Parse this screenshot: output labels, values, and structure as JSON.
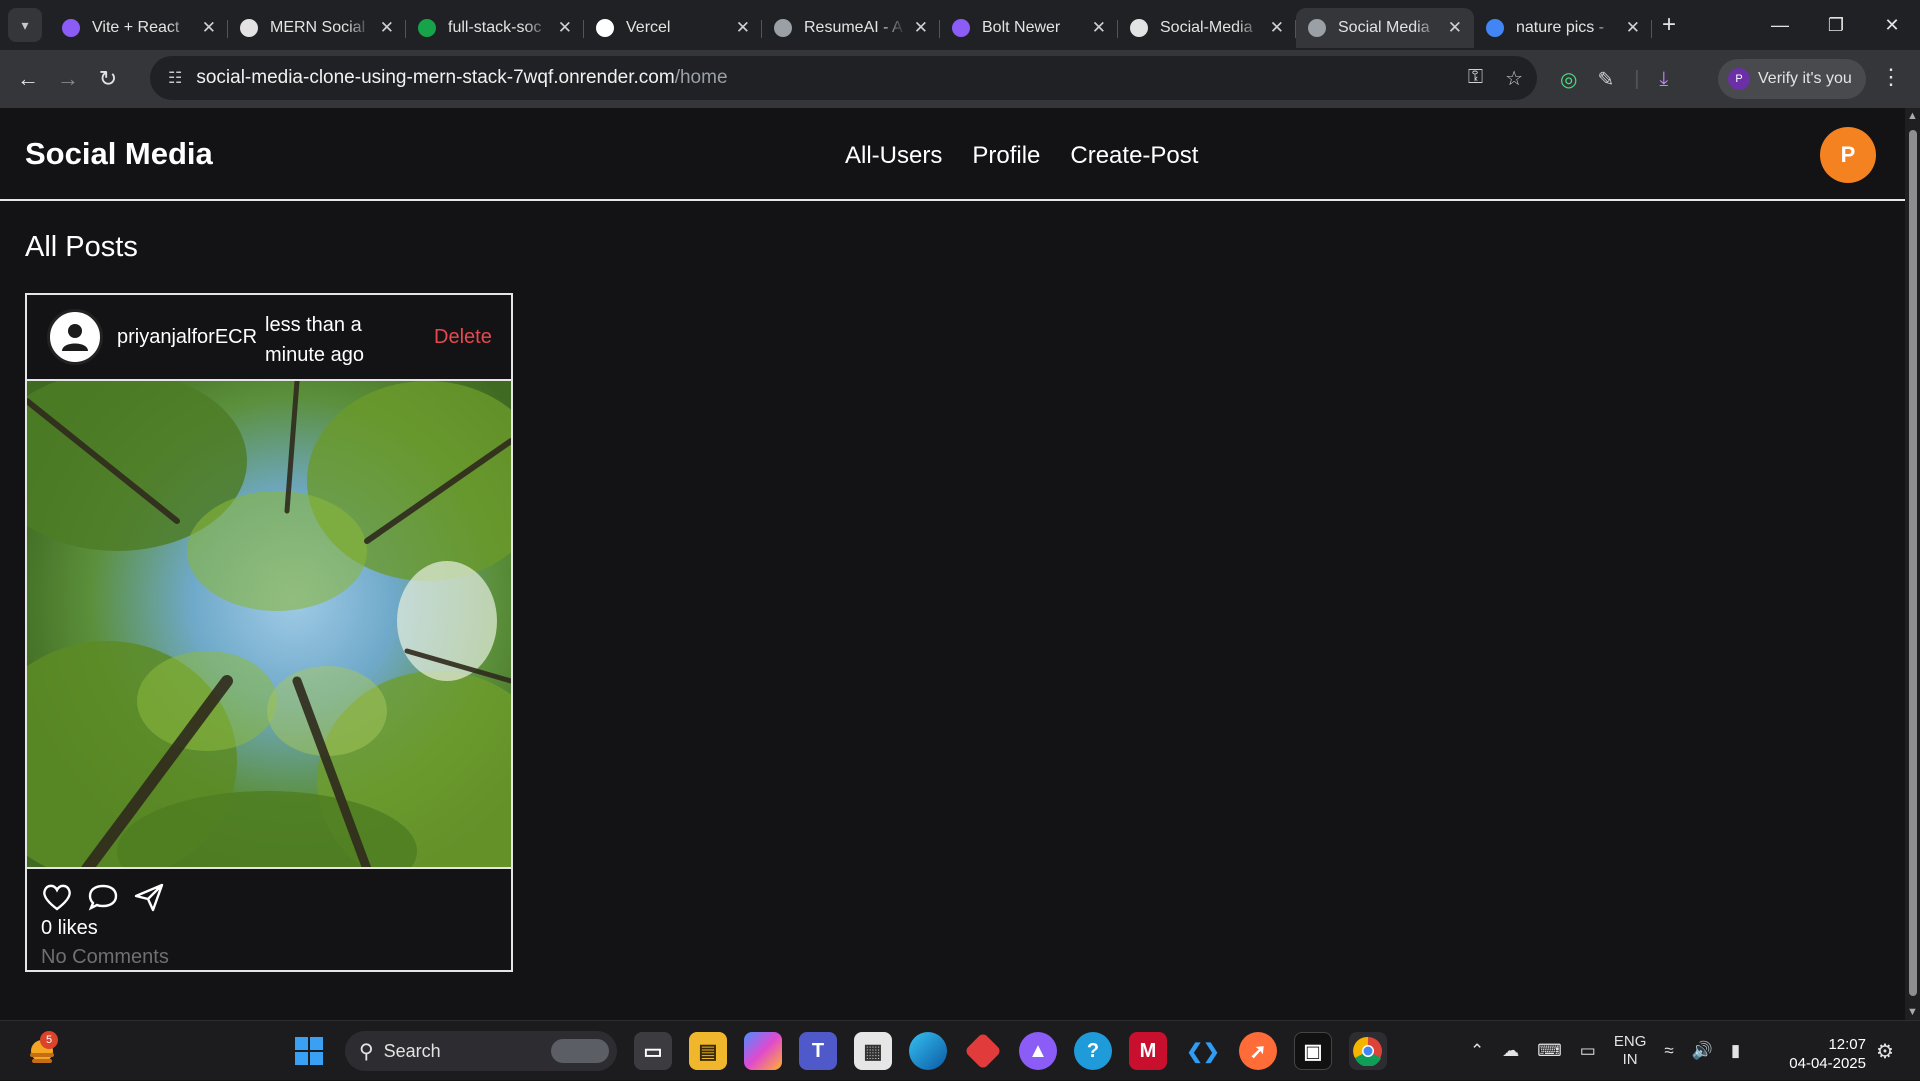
{
  "browser": {
    "tabs": [
      {
        "label": "Vite + React",
        "favicon_color": "#8b5cf6",
        "active": false
      },
      {
        "label": "MERN Social",
        "favicon_color": "#e3e3e3",
        "active": false
      },
      {
        "label": "full-stack-soc",
        "favicon_color": "#16a34a",
        "active": false
      },
      {
        "label": "Vercel",
        "favicon_color": "#ffffff",
        "active": false
      },
      {
        "label": "ResumeAI - A",
        "favicon_color": "#9aa0a6",
        "active": false
      },
      {
        "label": "Bolt Newer",
        "favicon_color": "#8b5cf6",
        "active": false
      },
      {
        "label": "Social-Media",
        "favicon_color": "#e3e3e3",
        "active": false
      },
      {
        "label": "Social Media",
        "favicon_color": "#9aa0a6",
        "active": true
      },
      {
        "label": "nature pics -",
        "favicon_color": "#4285f4",
        "active": false
      }
    ],
    "url_host": "social-media-clone-using-mern-stack-7wqf.onrender.com",
    "url_path": "/home",
    "verify_label": "Verify it's you",
    "profile_initial": "P"
  },
  "app": {
    "brand": "Social Media",
    "nav": [
      "All-Users",
      "Profile",
      "Create-Post"
    ],
    "user_initial": "P",
    "accent": "#f58220",
    "section_title": "All Posts",
    "post": {
      "username": "priyanjalforECR",
      "time": "less than a minute ago",
      "delete_label": "Delete",
      "likes": "0 likes",
      "comments": "No Comments"
    }
  },
  "taskbar": {
    "weather_badge": "5",
    "search_label": "Search",
    "lang_line1": "ENG",
    "lang_line2": "IN",
    "time": "12:07",
    "date": "04-04-2025"
  }
}
